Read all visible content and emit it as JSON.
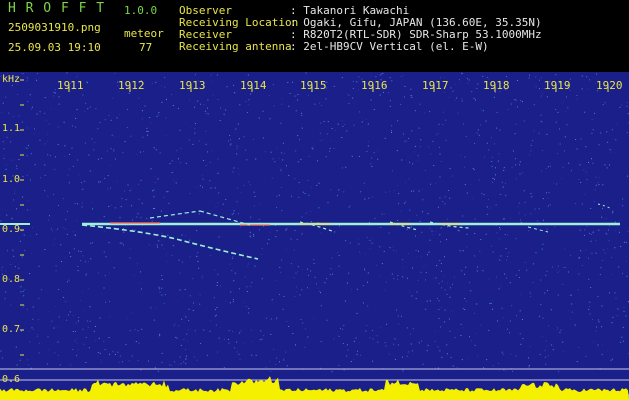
{
  "app": {
    "logo": "H R O F F T",
    "version": "1.0.0",
    "filename": "2509031910.png",
    "datetime": "25.09.03 19:10",
    "meteor_label": "meteor",
    "meteor_count": "77"
  },
  "info": {
    "labels": [
      "Observer",
      "Receiving Location",
      "Receiver",
      "Receiving antenna"
    ],
    "values": [
      ": Takanori Kawachi",
      ": Ogaki, Gifu, JAPAN (136.60E, 35.35N)",
      ": R820T2(RTL-SDR) SDR-Sharp 53.1000MHz",
      ": 2el-HB9CV Vertical (el. E-W)"
    ]
  },
  "axis": {
    "y_unit": "kHz",
    "y_ticks": [
      "1.1",
      "1.0",
      "0.9",
      "0.8",
      "0.7",
      "0.6"
    ],
    "x_ticks": [
      "1911",
      "1912",
      "1913",
      "1914",
      "1915",
      "1916",
      "1917",
      "1918",
      "1919",
      "1920"
    ]
  },
  "colors": {
    "background": "#000000",
    "plot": "#1a1f8a",
    "label": "#e8e64a",
    "title": "#7cd44a",
    "signal": "#9ef0d8",
    "level": "#f5f000",
    "baseline": "#2fb8e8"
  }
}
